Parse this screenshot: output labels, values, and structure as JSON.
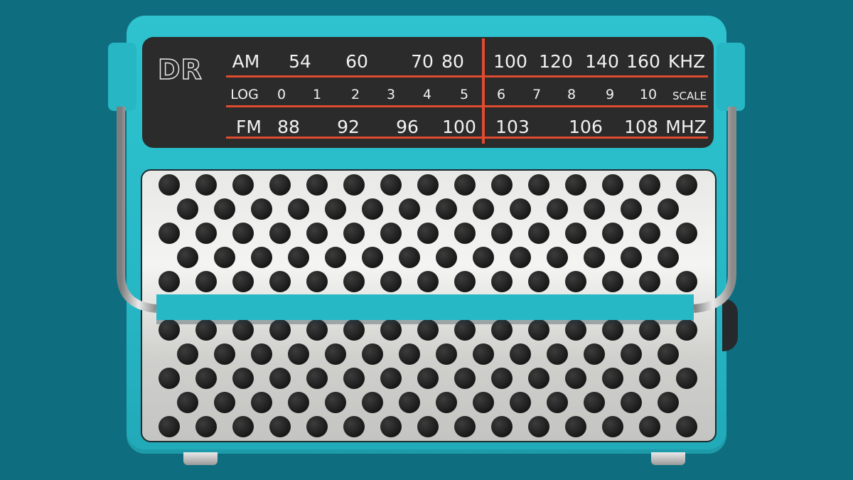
{
  "logo": "DR",
  "am": {
    "label": "AM",
    "ticks": [
      "54",
      "60",
      "70",
      "80",
      "100",
      "120",
      "140",
      "160"
    ],
    "unit": "KHZ"
  },
  "log": {
    "label": "LOG",
    "ticks": [
      "0",
      "1",
      "2",
      "3",
      "4",
      "5",
      "6",
      "7",
      "8",
      "9",
      "10"
    ],
    "unit": "SCALE"
  },
  "fm": {
    "label": "FM",
    "ticks": [
      "88",
      "92",
      "96",
      "100",
      "103",
      "106",
      "108"
    ],
    "unit": "MHZ"
  },
  "colors": {
    "background": "#0e6e80",
    "body": "#2ec3cf",
    "dial": "#2b2b2b",
    "needle": "#e04b30"
  }
}
